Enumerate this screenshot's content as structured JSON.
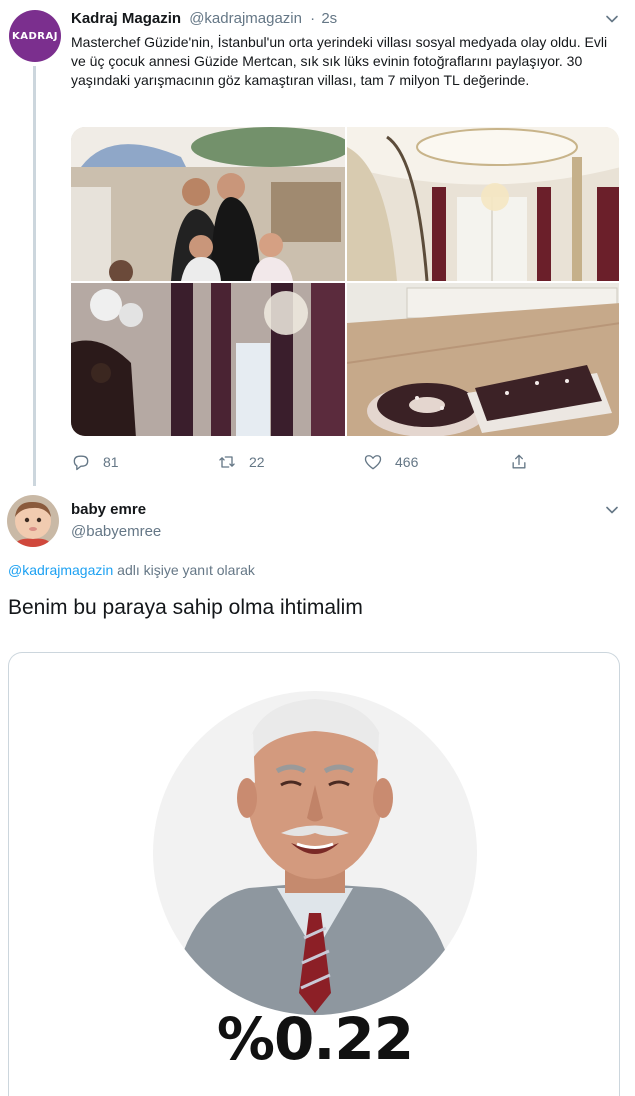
{
  "tweet": {
    "avatar_logo": "KADRAJ",
    "name": "Kadraj Magazin",
    "handle": "@kadrajmagazin",
    "separator": "·",
    "time": "2s",
    "text": "Masterchef Güzide'nin, İstanbul'un orta yerindeki villası sosyal medyada olay oldu. Evli ve üç çocuk annesi Güzide Mertcan, sık sık lüks evinin fotoğraflarını paylaşıyor. 30 yaşındaki yarışmacının göz kamaştıran villası, tam 7 milyon TL değerinde.",
    "photos": [
      "family-photo",
      "ceiling-chandelier-photo",
      "curtains-chandelier-photo",
      "kitchen-cake-photo"
    ],
    "replies": "81",
    "retweets": "22",
    "likes": "466"
  },
  "reply": {
    "name": "baby emre",
    "handle": "@babyemree",
    "replying_mention": "@kadrajmagazin",
    "replying_suffix": " adlı kişiye yanıt olarak",
    "text": "Benim bu paraya sahip olma ihtimalim",
    "image_caption": "%0.22"
  },
  "colors": {
    "accent": "#1da1f2",
    "secondary_text": "#657786",
    "primary_text": "#14171a",
    "brand_purple": "#7b2f8e",
    "thread_line": "#ccd6dd"
  }
}
